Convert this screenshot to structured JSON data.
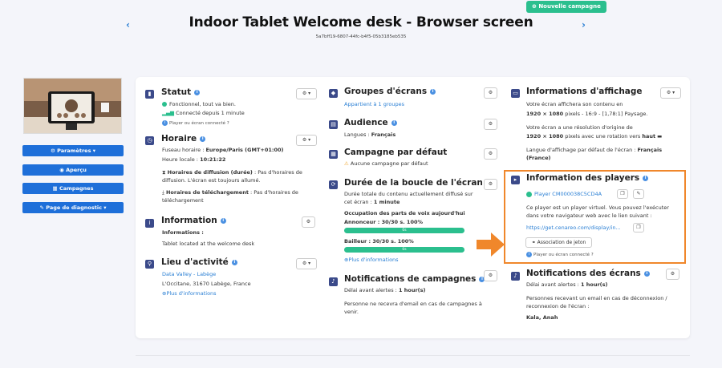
{
  "header": {
    "new_campaign": "Nouvelle campagne",
    "title": "Indoor Tablet Welcome desk - Browser screen",
    "uuid": "5a7bff19-6807-44fc-b4f5-05b3185eb535",
    "prev": "‹",
    "next": "›"
  },
  "sidebar": {
    "params": "Paramètres ▾",
    "preview": "Aperçu",
    "campaigns": "Campagnes",
    "diag": "Page de diagnostic ▾"
  },
  "statut": {
    "title": "Statut",
    "ok": "Fonctionnel, tout va bien.",
    "connected": "Connecté depuis 1 minute",
    "question": "Player ou écran connecté ?"
  },
  "horaire": {
    "title": "Horaire",
    "tz_label": "Fuseau horaire : ",
    "tz_value": "Europe/Paris (GMT+01:00)",
    "local_label": "Heure locale : ",
    "local_value": "10:21:22",
    "diff_label": "Horaires de diffusion (durée)",
    "diff_text": " : Pas d'horaires de diffusion. L'écran est toujours allumé.",
    "dl_label": "Horaires de téléchargement",
    "dl_text": " : Pas d'horaires de téléchargement"
  },
  "information": {
    "title": "Information",
    "label": "Informations :",
    "text": "Tablet located at the welcome desk"
  },
  "lieu": {
    "title": "Lieu d'activité",
    "name": "Data Valley - Labège",
    "address": "L'Occitane, 31670 Labège, France",
    "more": "Plus d'informations"
  },
  "groupes": {
    "title": "Groupes d'écrans",
    "text": "Appartient à 1 groupes"
  },
  "audience": {
    "title": "Audience",
    "label": "Langues : ",
    "value": "Français"
  },
  "campagne_defaut": {
    "title": "Campagne par défaut",
    "text": "Aucune campagne par défaut"
  },
  "boucle": {
    "title": "Durée de la boucle de l'écran",
    "total_text": "Durée totale du contenu actuellement diffusé sur cet écran : ",
    "total_value": "1 minute",
    "occupation": "Occupation des parts de voix aujourd'hui",
    "annonceur": "Annonceur : 30/30 s. 100%",
    "bailleur": "Bailleur : 30/30 s. 100%",
    "bar_label": "0s",
    "more": "Plus d'informations",
    "annonceur_fill": 100,
    "bailleur_fill": 100
  },
  "notif_campagnes": {
    "title": "Notifications de campagnes",
    "delay_label": "Délai avant alertes : ",
    "delay_value": "1 hour(s)",
    "text": "Personne ne recevra d'email en cas de campagnes à venir."
  },
  "affichage": {
    "title": "Informations d'affichage",
    "line1": "Votre écran affichera son contenu en",
    "res1": "1920 × 1080",
    "res1_suffix": " pixels - 16:9 - [1,78:1] Paysage.",
    "line2": "Votre écran a une résolution d'origine de",
    "res2": "1920 × 1080",
    "res2_mid": " pixels avec une rotation vers ",
    "res2_dir": "haut",
    "lang_label": "Langue d'affichage par défaut de l'écran : ",
    "lang_value": "Français (France)"
  },
  "players": {
    "title": "Information des players",
    "player_name": "Player CM000038C5CD4A",
    "desc": "Ce player est un player virtuel. Vous pouvez l'exécuter dans votre navigateur web avec le lien suivant :",
    "url": "https://get.cenareo.com/display/in...",
    "token_btn": "Association de jeton",
    "question": "Player ou écran connecté ?"
  },
  "notif_ecrans": {
    "title": "Notifications des écrans",
    "delay_label": "Délai avant alertes : ",
    "delay_value": "1 hour(s)",
    "text": "Personnes recevant un email en cas de déconnexion / reconnexion de l'écran :",
    "names": "Kala, Anah"
  },
  "colors": {
    "accent": "#1e6fd9",
    "success": "#2bbf8e",
    "highlight": "#f0872b",
    "icon": "#3b4a8a"
  }
}
